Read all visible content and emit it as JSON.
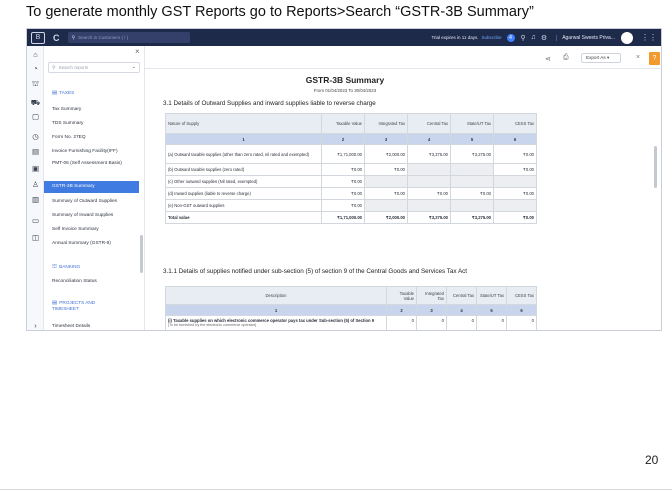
{
  "slide": {
    "title": "To generate monthly GST Reports go to Reports>Search “GSTR-3B Summary”",
    "page_number": "20"
  },
  "topbar": {
    "logo": "B",
    "refresh": "C",
    "search_placeholder": "Search in Customers ( / )",
    "trial_text": "Trial expires in 11 days.",
    "subscribe": "Subscribe",
    "badge": "4",
    "company": "Agarwal Sweets Priva...",
    "icons": [
      "store-icon",
      "bell-icon",
      "settings-icon",
      "apps-grid-icon"
    ]
  },
  "rail": {
    "icons": [
      "home-icon",
      "dashboard-icon",
      "bank-icon",
      "cart-icon",
      "bag-icon",
      "time-icon",
      "document-icon",
      "reports-icon",
      "people-icon",
      "chart-icon",
      "wallet-icon",
      "apps-icon",
      "expand-icon"
    ]
  },
  "menu": {
    "search_placeholder": "Search reports",
    "section_taxes": "TAXES",
    "items_taxes": [
      "Tax Summary",
      "TDS Summary",
      "Form No. 27EQ",
      "Invoice Furnishing Facility(IFF)",
      "PMT-06 (Self Assessment Basis)",
      "GSTR-3B Summary",
      "Summary of Outward Supplies",
      "Summary of Inward Supplies",
      "Self Invoice Summary",
      "Annual Summary (GSTR-9)"
    ],
    "section_banking": "BANKING",
    "items_banking": [
      "Reconciliation Status"
    ],
    "section_projects": "PROJECTS AND TIMESHEET",
    "items_projects": [
      "Timesheet Details"
    ]
  },
  "toolbar": {
    "export_label": "Export As"
  },
  "report": {
    "title": "GSTR-3B Summary",
    "period": "From 01/04/2023  To 30/04/2023",
    "section_31_title": "3.1 Details of Outward Supplies and inward supplies liable to reverse charge",
    "t1_headers": [
      "Nature of Supply",
      "Taxable Value",
      "Integrated Tax",
      "Central Tax",
      "State/UT Tax",
      "CESS Tax"
    ],
    "t1_numbers": [
      "1",
      "2",
      "3",
      "4",
      "5",
      "6"
    ],
    "t1_rows": [
      {
        "label": "(a) Outward taxable supplies (other than zero rated, nil rated and exempted)",
        "v": [
          "₹1,71,000.00",
          "₹2,000.00",
          "₹3,275.00",
          "₹3,275.00",
          "₹0.00"
        ]
      },
      {
        "label": "(b) Outward taxable supplies (zero rated)",
        "v": [
          "₹0.00",
          "₹0.00",
          "",
          "",
          "₹0.00"
        ]
      },
      {
        "label": "(c) Other outward supplies (Nil rated, exempted)",
        "v": [
          "₹0.00",
          "",
          "",
          "",
          ""
        ]
      },
      {
        "label": "(d) Inward supplies (liable to reverse charge)",
        "v": [
          "₹0.00",
          "₹0.00",
          "₹0.00",
          "₹0.00",
          "₹0.00"
        ]
      },
      {
        "label": "(e) Non-GST outward supplies",
        "v": [
          "₹0.00",
          "",
          "",
          "",
          ""
        ]
      },
      {
        "label": "Total value",
        "v": [
          "₹1,71,000.00",
          "₹2,000.00",
          "₹3,275.00",
          "₹3,275.00",
          "₹0.00"
        ]
      }
    ],
    "section_311_title": "3.1.1 Details of supplies notified under sub-section (5) of section 9 of the Central Goods and Services Tax Act",
    "t2_headers": [
      "Description",
      "Taxable Value",
      "Integrated Tax",
      "Central Tax",
      "State/UT Tax",
      "CESS Tax"
    ],
    "t2_numbers": [
      "1",
      "2",
      "3",
      "4",
      "5",
      "6"
    ],
    "t2_row": {
      "label": "(i) Taxable supplies on which electronic commerce operator pays tax under Sub-section (5) of Section 9",
      "note": "[To be furnished by the electronic commerce operator]",
      "v": [
        "0",
        "0",
        "0",
        "0",
        "0"
      ]
    }
  }
}
